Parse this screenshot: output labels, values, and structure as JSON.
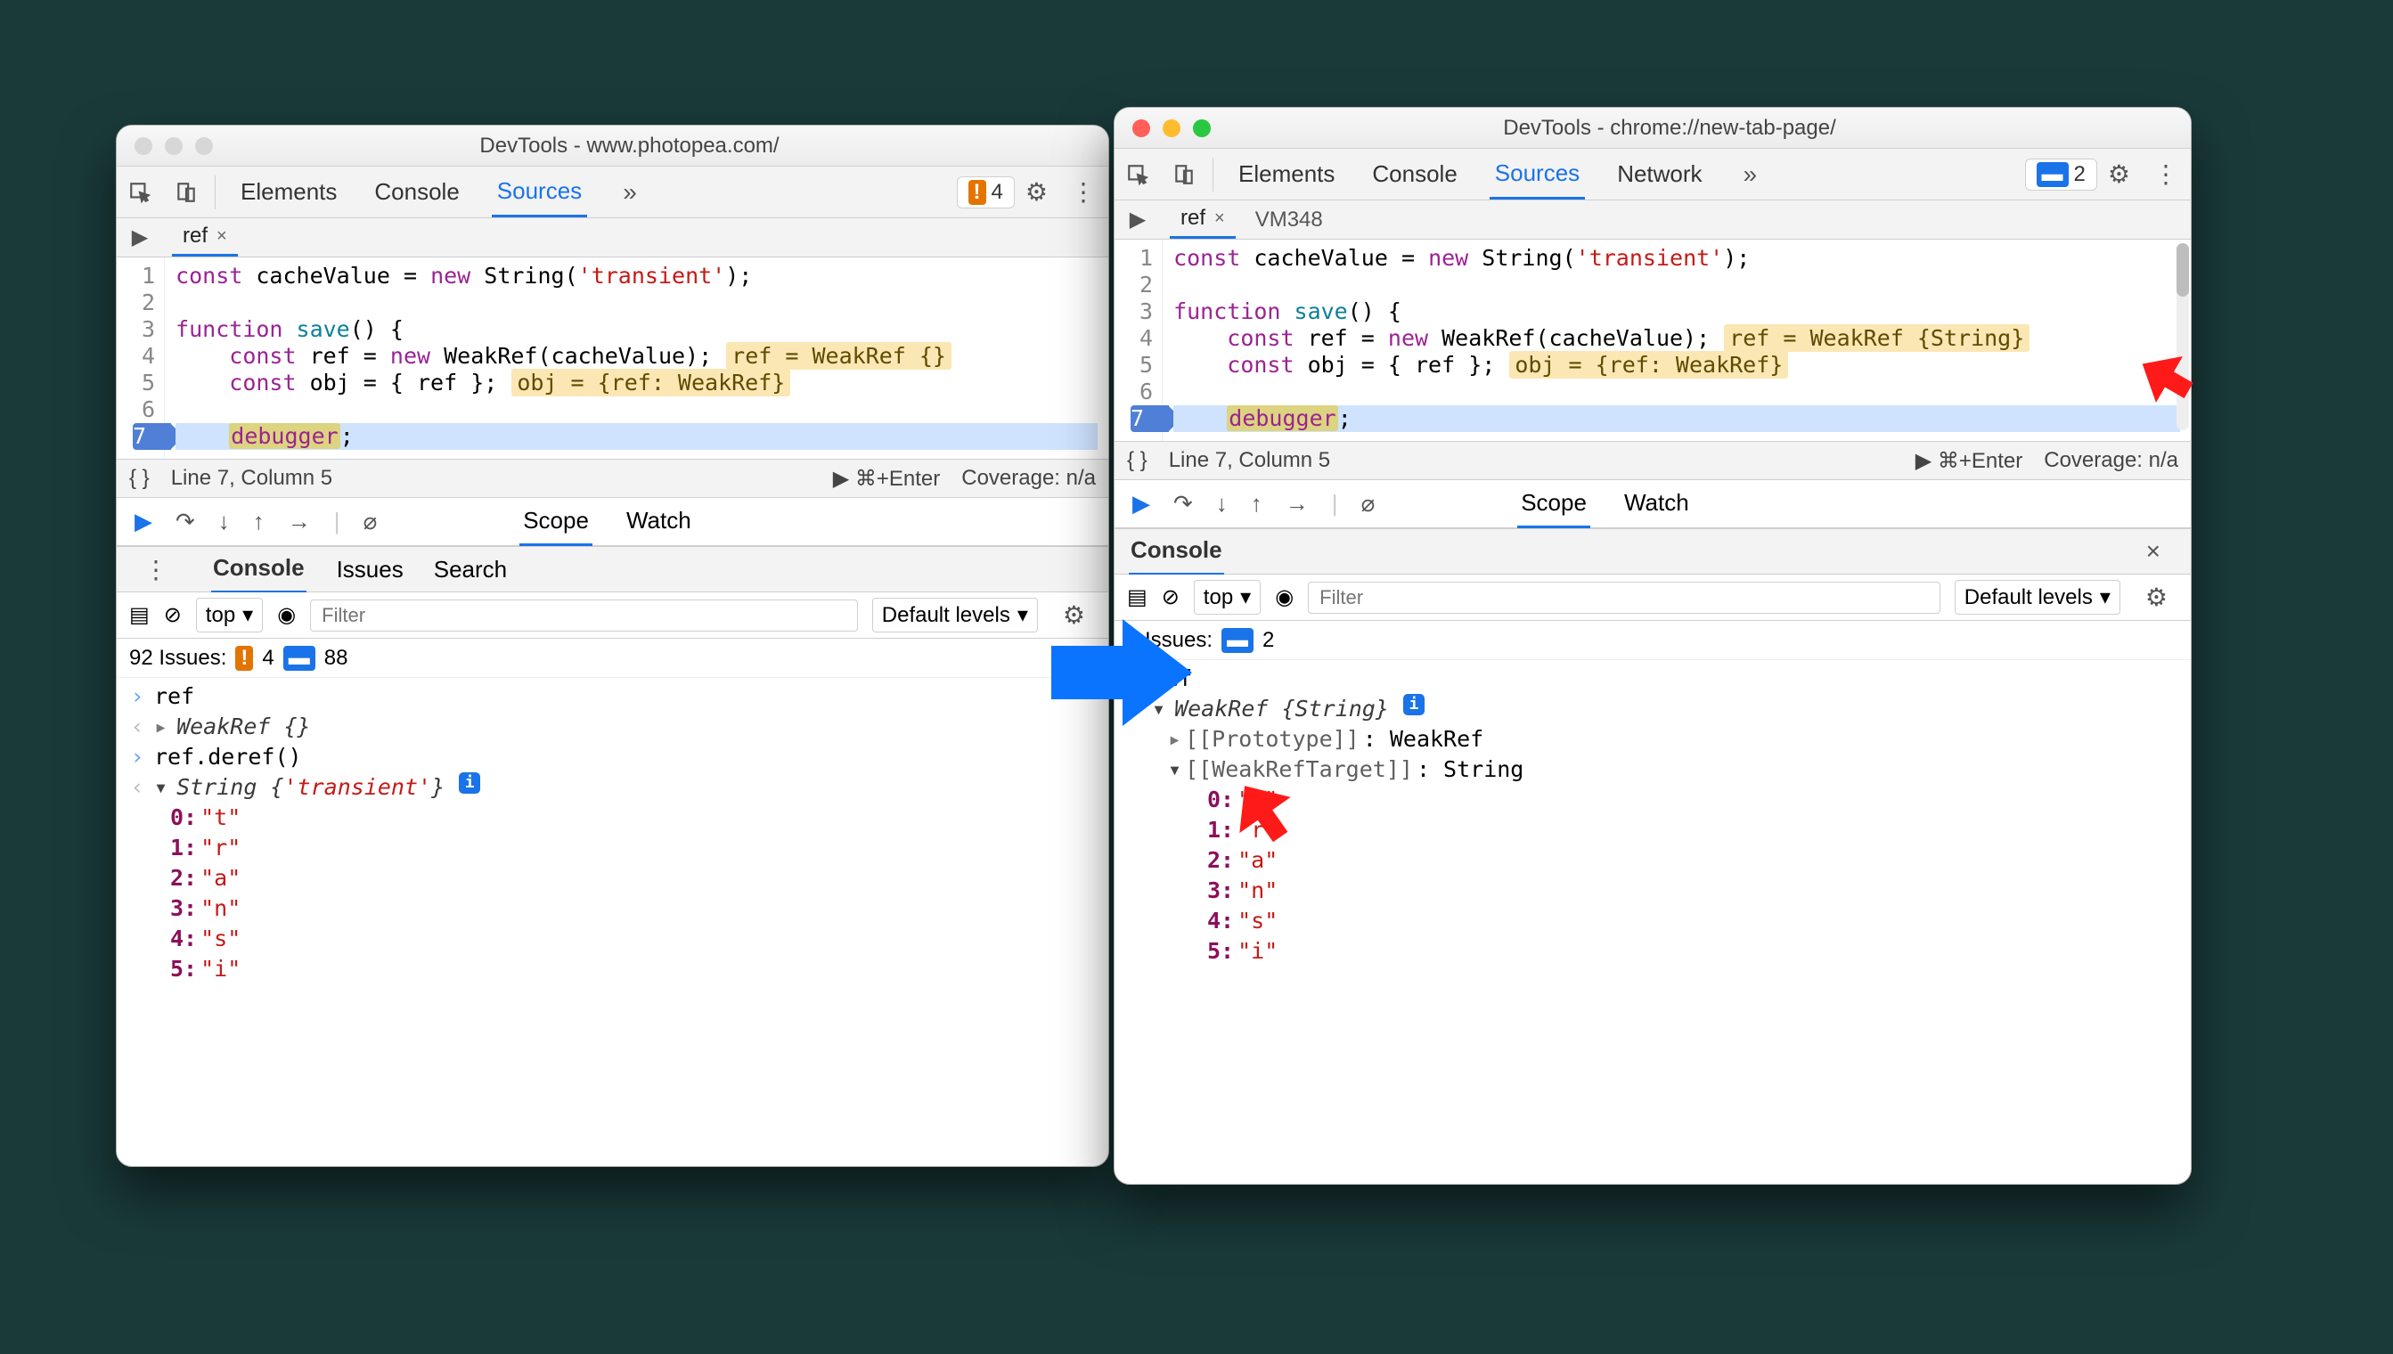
{
  "left": {
    "title": "DevTools - www.photopea.com/",
    "tabs": [
      "Elements",
      "Console",
      "Sources"
    ],
    "active_tab": "Sources",
    "warn_count": "4",
    "file_tab": "ref",
    "extra_file": "",
    "code": {
      "l1": {
        "a": "const ",
        "b": "cacheValue ",
        "c": "= ",
        "d": "new ",
        "e": "String",
        "f": "(",
        "g": "'transient'",
        "h": ");"
      },
      "l3": {
        "a": "function ",
        "b": "save",
        "c": "() {"
      },
      "l4": {
        "a": "    const ",
        "b": "ref ",
        "c": "= ",
        "d": "new ",
        "e": "WeakRef",
        "f": "(cacheValue);",
        "hint": "ref = WeakRef {}"
      },
      "l5": {
        "a": "    const ",
        "b": "obj ",
        "c": "= { ref };",
        "hint": "obj = {ref: WeakRef}"
      },
      "l7": {
        "a": "    ",
        "b": "debugger",
        "c": ";"
      }
    },
    "status": {
      "pos": "Line 7, Column 5",
      "run": "⌘+Enter",
      "cov": "Coverage: n/a"
    },
    "dbg_tabs": [
      "Scope",
      "Watch"
    ],
    "drawer_tabs": [
      "Console",
      "Issues",
      "Search"
    ],
    "context": "top",
    "filter_ph": "Filter",
    "levels": "Default levels",
    "issues_label": "92 Issues:",
    "issues_warn": "4",
    "issues_info": "88",
    "console": {
      "in1": "ref",
      "out1": "WeakRef {}",
      "in2": "ref.deref()",
      "out2a": "String ",
      "out2b": "{",
      "out2c": "'transient'",
      "out2d": "}",
      "chars": [
        {
          "k": "0",
          "v": "\"t\""
        },
        {
          "k": "1",
          "v": "\"r\""
        },
        {
          "k": "2",
          "v": "\"a\""
        },
        {
          "k": "3",
          "v": "\"n\""
        },
        {
          "k": "4",
          "v": "\"s\""
        },
        {
          "k": "5",
          "v": "\"i\""
        }
      ]
    }
  },
  "right": {
    "title": "DevTools - chrome://new-tab-page/",
    "tabs": [
      "Elements",
      "Console",
      "Sources",
      "Network"
    ],
    "active_tab": "Sources",
    "info_count": "2",
    "file_tab": "ref",
    "extra_file": "VM348",
    "code": {
      "l1": {
        "a": "const ",
        "b": "cacheValue ",
        "c": "= ",
        "d": "new ",
        "e": "String",
        "f": "(",
        "g": "'transient'",
        "h": ");"
      },
      "l3": {
        "a": "function ",
        "b": "save",
        "c": "() {"
      },
      "l4": {
        "a": "    const ",
        "b": "ref ",
        "c": "= ",
        "d": "new ",
        "e": "WeakRef",
        "f": "(cacheValue);",
        "hint": "ref = WeakRef {String}"
      },
      "l5": {
        "a": "    const ",
        "b": "obj ",
        "c": "= { ref };",
        "hint": "obj = {ref: WeakRef}"
      },
      "l7": {
        "a": "    ",
        "b": "debugger",
        "c": ";"
      }
    },
    "status": {
      "pos": "Line 7, Column 5",
      "run": "⌘+Enter",
      "cov": "Coverage: n/a"
    },
    "dbg_tabs": [
      "Scope",
      "Watch"
    ],
    "drawer_tabs": [
      "Console"
    ],
    "context": "top",
    "filter_ph": "Filter",
    "levels": "Default levels",
    "issues_label": "2 Issues:",
    "issues_info": "2",
    "console": {
      "in1": "ref",
      "out1a": "WeakRef ",
      "out1b": "{String}",
      "proto_label": "[[Prototype]]",
      "proto_val": ": WeakRef",
      "target_label": "[[WeakRefTarget]]",
      "target_val": ": String",
      "chars": [
        {
          "k": "0",
          "v": "\"t\""
        },
        {
          "k": "1",
          "v": "\"r\""
        },
        {
          "k": "2",
          "v": "\"a\""
        },
        {
          "k": "3",
          "v": "\"n\""
        },
        {
          "k": "4",
          "v": "\"s\""
        },
        {
          "k": "5",
          "v": "\"i\""
        }
      ]
    }
  }
}
